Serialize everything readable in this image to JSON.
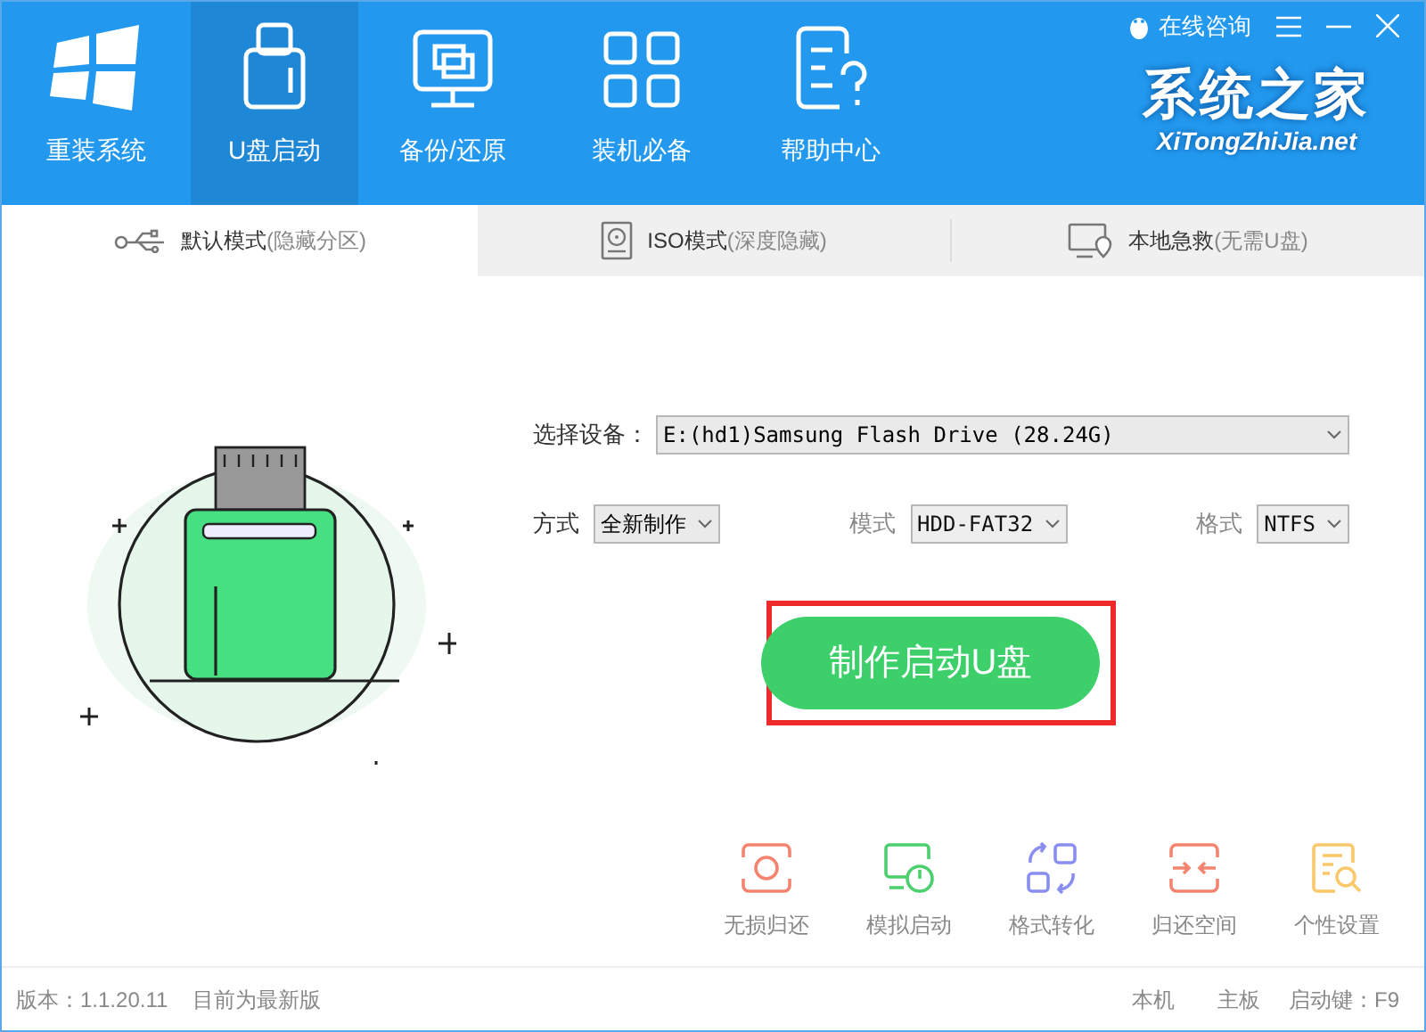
{
  "top_links": {
    "consult": "在线咨询"
  },
  "logo": {
    "name": "系统之家",
    "domain": "XiTongZhiJia.net"
  },
  "nav": [
    {
      "label": "重装系统",
      "kind": "windows",
      "selected": false
    },
    {
      "label": "U盘启动",
      "kind": "usb",
      "selected": true
    },
    {
      "label": "备份/还原",
      "kind": "backup",
      "selected": false
    },
    {
      "label": "装机必备",
      "kind": "apps",
      "selected": false
    },
    {
      "label": "帮助中心",
      "kind": "help",
      "selected": false
    }
  ],
  "tabs": [
    {
      "label": "默认模式",
      "note": "(隐藏分区)",
      "kind": "usb",
      "selected": true
    },
    {
      "label": "ISO模式",
      "note": "(深度隐藏)",
      "kind": "iso",
      "selected": false
    },
    {
      "label": "本地急救",
      "note": "(无需U盘)",
      "kind": "local",
      "selected": false
    }
  ],
  "device": {
    "label": "选择设备：",
    "value": "E:(hd1)Samsung Flash Drive (28.24G)"
  },
  "options": [
    {
      "label": "方式",
      "value": "全新制作",
      "enabled": true
    },
    {
      "label": "模式",
      "value": "HDD-FAT32",
      "enabled": false
    },
    {
      "label": "格式",
      "value": "NTFS",
      "enabled": false
    }
  ],
  "make_button": "制作启动U盘",
  "highlighted": true,
  "tools": [
    {
      "label": "无损归还",
      "kind": "restore",
      "color": "#f4846f"
    },
    {
      "label": "模拟启动",
      "kind": "simulate",
      "color": "#4ccf6e"
    },
    {
      "label": "格式转化",
      "kind": "convert",
      "color": "#8a8ef0"
    },
    {
      "label": "归还空间",
      "kind": "space",
      "color": "#f4846f"
    },
    {
      "label": "个性设置",
      "kind": "settings",
      "color": "#f9c86a"
    }
  ],
  "status_bar": {
    "version": "版本：1.1.20.11",
    "update": "目前为最新版",
    "machine": "本机",
    "board": "主板",
    "boot_key": "启动键：F9"
  }
}
